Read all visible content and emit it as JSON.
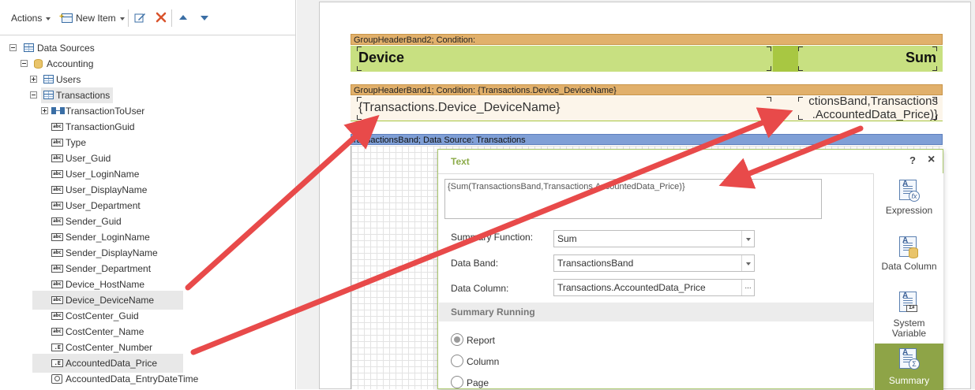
{
  "toolbar": {
    "actions_label": "Actions",
    "new_item_label": "New Item"
  },
  "tree": {
    "root": "Data Sources",
    "datasource": "Accounting",
    "tables": [
      "Users",
      "Transactions"
    ],
    "relation": "TransactionToUser",
    "fields": [
      {
        "name": "TransactionGuid",
        "type": "string",
        "highlighted": false
      },
      {
        "name": "Type",
        "type": "string",
        "highlighted": false
      },
      {
        "name": "User_Guid",
        "type": "string",
        "highlighted": false
      },
      {
        "name": "User_LoginName",
        "type": "string",
        "highlighted": false
      },
      {
        "name": "User_DisplayName",
        "type": "string",
        "highlighted": false
      },
      {
        "name": "User_Department",
        "type": "string",
        "highlighted": false
      },
      {
        "name": "Sender_Guid",
        "type": "string",
        "highlighted": false
      },
      {
        "name": "Sender_LoginName",
        "type": "string",
        "highlighted": false
      },
      {
        "name": "Sender_DisplayName",
        "type": "string",
        "highlighted": false
      },
      {
        "name": "Sender_Department",
        "type": "string",
        "highlighted": false
      },
      {
        "name": "Device_HostName",
        "type": "string",
        "highlighted": false
      },
      {
        "name": "Device_DeviceName",
        "type": "string",
        "highlighted": true
      },
      {
        "name": "CostCenter_Guid",
        "type": "string",
        "highlighted": false
      },
      {
        "name": "CostCenter_Name",
        "type": "string",
        "highlighted": false
      },
      {
        "name": "CostCenter_Number",
        "type": "number",
        "highlighted": false
      },
      {
        "name": "AccountedData_Price",
        "type": "number",
        "highlighted": true
      },
      {
        "name": "AccountedData_EntryDateTime",
        "type": "datetime",
        "highlighted": false
      }
    ],
    "highlight_color": "#fdfb8c"
  },
  "designer": {
    "band2_header": "GroupHeaderBand2; Condition:",
    "band2_device": "Device",
    "band2_sum": "Sum",
    "band1_header": "GroupHeaderBand1; Condition: {Transactions.Device_DeviceName}",
    "band1_device_expr": "{Transactions.Device_DeviceName}",
    "band1_sum_line1": "ctionsBand,Transactions",
    "band1_sum_line2": ".AccountedData_Price)}",
    "data_band_header": "ransactionsBand; Data Source: Transactions",
    "colors": {
      "band_orange": "#e1b06b",
      "band_green": "#c8e081",
      "band_green_dark": "#a8c742",
      "band_blue": "#7f9fd6",
      "band_cream": "#fcf5ea"
    }
  },
  "dialog": {
    "title": "Text",
    "help_label": "?",
    "close_label": "×",
    "expression": "{Sum(TransactionsBand,Transactions.AccountedData_Price)}",
    "summary_function_label": "Summary Function:",
    "summary_function_value": "Sum",
    "data_band_label": "Data Band:",
    "data_band_value": "TransactionsBand",
    "data_column_label": "Data Column:",
    "data_column_value": "Transactions.AccountedData_Price",
    "ellipsis_label": "...",
    "summary_running_header": "Summary Running",
    "running_options": [
      {
        "label": "Report",
        "selected": true
      },
      {
        "label": "Column",
        "selected": false
      },
      {
        "label": "Page",
        "selected": false
      }
    ],
    "side_buttons": {
      "expression": "Expression",
      "data_column": "Data Column",
      "system_variable_line1": "System",
      "system_variable_line2": "Variable",
      "summary": "Summary"
    },
    "accent_color": "#8ea447"
  },
  "annotations": {
    "arrow_color": "#e84a4a"
  }
}
